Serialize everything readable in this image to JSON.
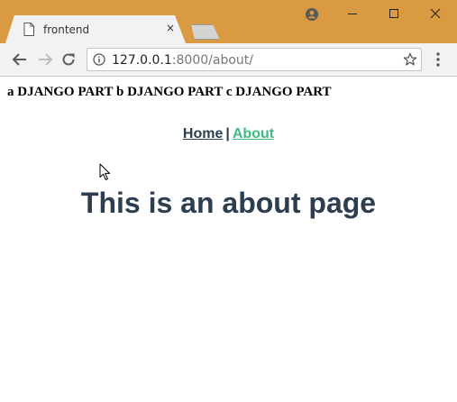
{
  "browser": {
    "tab_title": "frontend",
    "tab_close_glyph": "×",
    "url_host": "127.0.0.1",
    "url_rest": ":8000/about/",
    "colors": {
      "titlebar": "#d99a41",
      "toolbar": "#f2f2f2"
    }
  },
  "page": {
    "header_line": "a DJANGO PART b DJANGO PART c DJANGO PART",
    "nav": {
      "home": "Home",
      "separator": "|",
      "about": "About"
    },
    "heading": "This is an about page",
    "colors": {
      "text": "#2c3e50",
      "active_link": "#42b983"
    }
  }
}
